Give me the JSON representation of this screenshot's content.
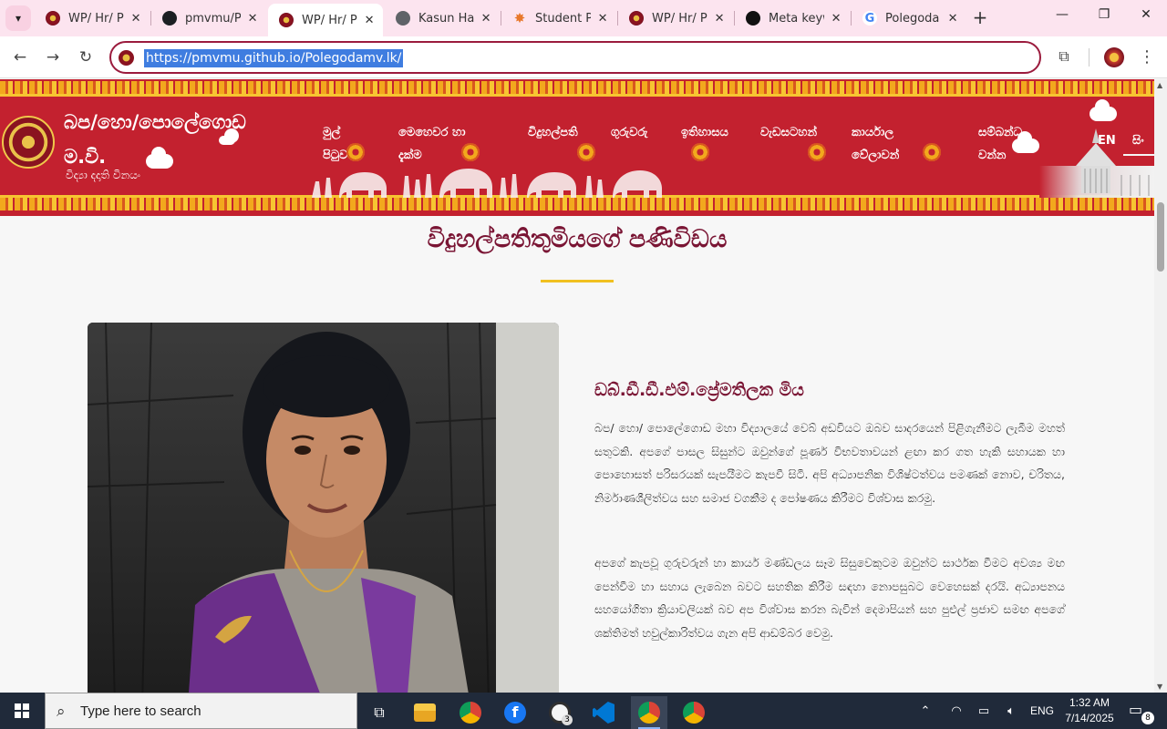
{
  "browser": {
    "tabs": [
      {
        "title": "WP/ Hr/ Po",
        "favicon": "crest-icon",
        "active": false
      },
      {
        "title": "pmvmu/Po",
        "favicon": "github-icon",
        "active": false
      },
      {
        "title": "WP/ Hr/ Po",
        "favicon": "crest-icon",
        "active": true
      },
      {
        "title": "Kasun Hari",
        "favicon": "globe-icon",
        "active": false
      },
      {
        "title": "Student Pr",
        "favicon": "star-icon",
        "active": false
      },
      {
        "title": "WP/ Hr/ Po",
        "favicon": "crest-icon",
        "active": false
      },
      {
        "title": "Meta keyw",
        "favicon": "meta-icon",
        "active": false
      },
      {
        "title": "Polegoda I",
        "favicon": "google-icon",
        "active": false
      }
    ],
    "url": "https://pmvmu.github.io/Polegodamv.lk/",
    "accent_color": "#9b1b3d"
  },
  "site": {
    "name": "බප/හො/පොලේගොඩ ම.වි.",
    "motto": "විද්‍යා දදාති විනයං",
    "nav": [
      "මුල් පිටුව",
      "මෙහෙවර හා දැක්ම",
      "විදුහල්පති",
      "ගුරුවරු",
      "ඉතිහාසය",
      "වැඩසටහන්",
      "කාර්යාල වේලාවන්",
      "සම්බන්ධ වන්න"
    ],
    "lang_en": "EN",
    "lang_si": "සිං",
    "header_color": "#c3212f"
  },
  "content": {
    "page_title": "විදුහල්පතිතුමියගේ පණිවිඩය",
    "principal_name": "ඩබ්.ඩී.ඩී.එම්.ප්‍රේමතිලක මිය",
    "paragraphs": [
      "බප/ හො/ පොලේගොඩ මහා විද්‍යාලයේ වෙබ් අඩවියට ඔබව සාදරයෙන් පිළිගැනීමට ලැබීම මහත් සතුටකි. අපගේ පාසල සිසුන්ට ඔවුන්ගේ පූර්ණ විභවතාවයන් ළඟා කර ගත හැකි සහායක හා පොහොසත් පරිසරයක් සැපයීමට කැපවී සිටී. අපි අධ්‍යාපනික විශිෂ්ටත්වය පමණක් නොව, චරිතය, නිර්මාණශීලිත්වය සහ සමාජ වගකීම ද පෝෂණය කිරීමට විශ්වාස කරමු.",
      "අපගේ කැපවූ ගුරුවරුන් හා කාර්ය මණ්ඩලය සෑම සිසුවෙකුටම ඔවුන්ට සාර්ථක වීමට අවශ්‍ය මඟ පෙන්වීම හා සහාය ලැබෙන බවට සහතික කිරීම සඳහා නොපසුබට වෙහෙසක් දරයි. අධ්‍යාපනය සහයෝගිතා ක්‍රියාවලියක් බව අප විශ්වාස කරන බැවින් දෙමාපියන් සහ පුළුල් ප්‍රජාව සමඟ අපගේ ශක්තිමත් හවුල්කාරිත්වය ගැන අපි ආඩම්බර වෙමු."
    ]
  },
  "taskbar": {
    "search_placeholder": "Type here to search",
    "apps": [
      {
        "name": "task-view-icon",
        "badge": ""
      },
      {
        "name": "file-explorer-icon",
        "badge": ""
      },
      {
        "name": "chrome-profile-a-icon",
        "badge": ""
      },
      {
        "name": "facebook-icon",
        "badge": ""
      },
      {
        "name": "whatsapp-icon",
        "badge": "3"
      },
      {
        "name": "vscode-icon",
        "badge": ""
      },
      {
        "name": "chrome-icon",
        "badge": ""
      },
      {
        "name": "chrome-alt-icon",
        "badge": ""
      }
    ],
    "language": "ENG",
    "time": "1:32 AM",
    "date": "7/14/2025",
    "notifications": "8"
  }
}
